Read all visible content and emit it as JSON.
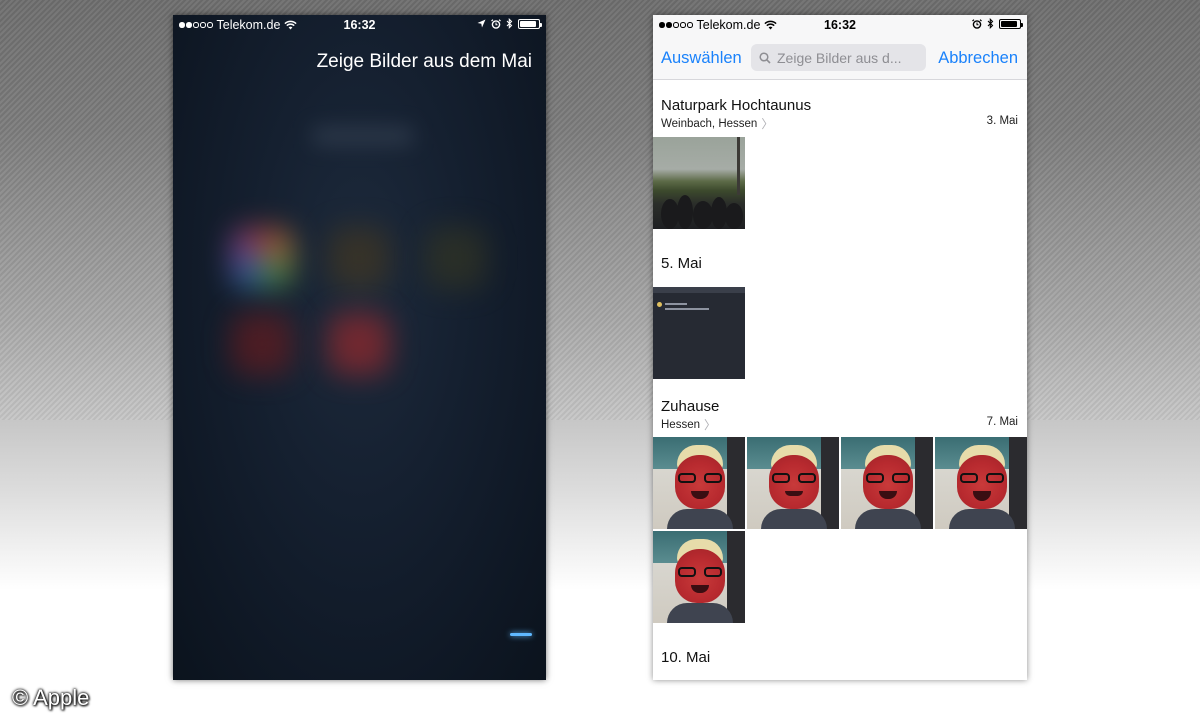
{
  "credit": "© Apple",
  "left_phone": {
    "status": {
      "carrier": "Telekom.de",
      "time": "16:32"
    },
    "siri_query": "Zeige Bilder aus dem Mai"
  },
  "right_phone": {
    "status": {
      "carrier": "Telekom.de",
      "time": "16:32"
    },
    "nav": {
      "select_label": "Auswählen",
      "search_placeholder": "Zeige Bilder aus d...",
      "cancel_label": "Abbrechen"
    },
    "sections": [
      {
        "title": "Naturpark Hochtaunus",
        "subtitle": "Weinbach, Hessen",
        "date": "3. Mai"
      },
      {
        "title": "5. Mai"
      },
      {
        "title": "Zuhause",
        "subtitle": "Hessen",
        "date": "7. Mai"
      },
      {
        "title": "10. Mai"
      }
    ]
  },
  "colors": {
    "accent": "#1a82fb"
  },
  "icons": [
    "wifi-icon",
    "location-icon",
    "alarm-icon",
    "bluetooth-icon",
    "battery-icon",
    "search-icon",
    "chevron-right-icon"
  ]
}
